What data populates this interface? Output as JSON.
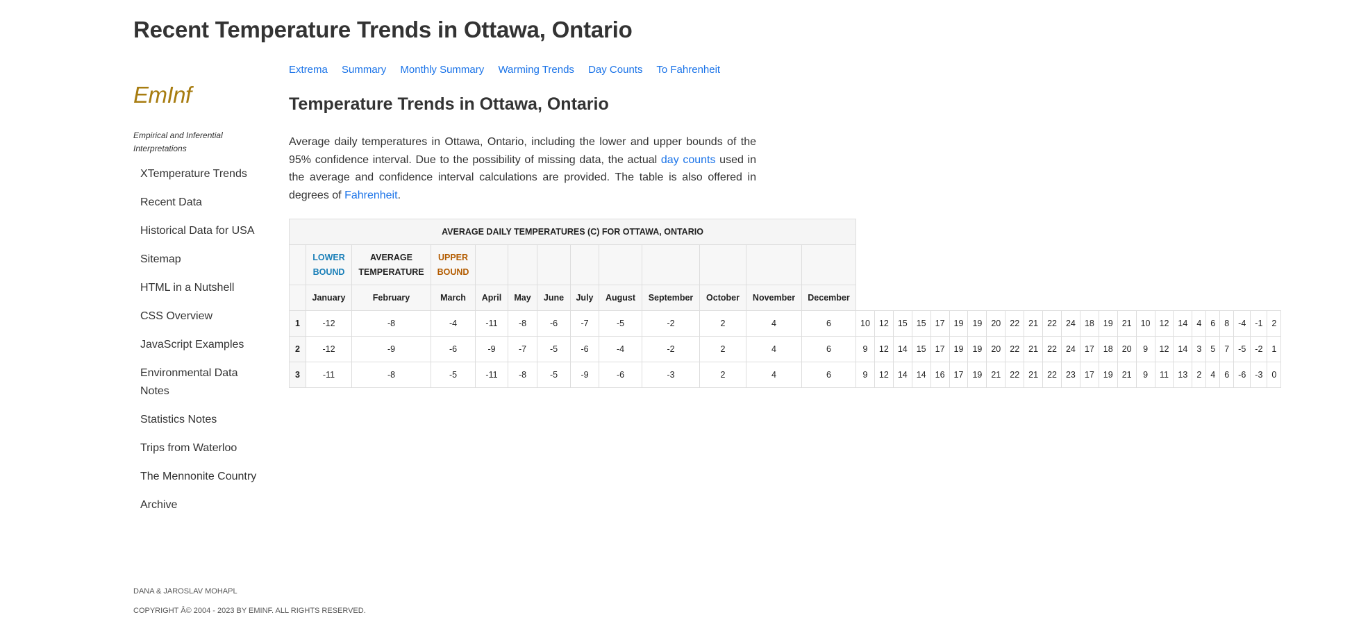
{
  "page_title": "Recent Temperature Trends in Ottawa, Ontario",
  "sidebar": {
    "logo": "EmInf",
    "tagline": "Empirical and Inferential Interpretations",
    "items": [
      {
        "label": "XTemperature Trends"
      },
      {
        "label": "Recent Data"
      },
      {
        "label": "Historical Data for USA"
      },
      {
        "label": "Sitemap"
      },
      {
        "label": "HTML in a Nutshell"
      },
      {
        "label": "CSS Overview"
      },
      {
        "label": "JavaScript Examples"
      },
      {
        "label": "Environmental Data Notes"
      },
      {
        "label": "Statistics Notes"
      },
      {
        "label": "Trips from Waterloo"
      },
      {
        "label": "The Mennonite Country"
      },
      {
        "label": "Archive"
      }
    ]
  },
  "footer": {
    "authors": "DANA & JAROSLAV MOHAPL",
    "copyright": "COPYRIGHT Â© 2004 - 2023 BY EmInf. ALL RIGHTS RESERVED."
  },
  "topnav": [
    "Extrema",
    "Summary",
    "Monthly Summary",
    "Warming Trends",
    "Day Counts",
    "To Fahrenheit"
  ],
  "section_title": "Temperature Trends in Ottawa, Ontario",
  "intro": {
    "part1": "Average daily temperatures in Ottawa, Ontario, including the lower and upper bounds of the 95% confidence interval. Due to the possibility of missing data, the actual ",
    "link1": "day counts",
    "part2": " used in the average and confidence interval calculations are provided. The table is also offered in degrees of ",
    "link2": "Fahrenheit",
    "part3": "."
  },
  "table": {
    "caption": "AVERAGE DAILY TEMPERATURES (C) FOR OTTAWA, ONTARIO",
    "lower_label": "LOWER BOUND",
    "avg_label": "AVERAGE TEMPERATURE",
    "upper_label": "UPPER BOUND",
    "colors": {
      "lower": "#1a7fb8",
      "upper": "#b35c00"
    },
    "months": [
      "January",
      "February",
      "March",
      "April",
      "May",
      "June",
      "July",
      "August",
      "September",
      "October",
      "November",
      "December"
    ],
    "rows": [
      {
        "idx": "1",
        "values": [
          "-12",
          "-8",
          "-4",
          "-11",
          "-8",
          "-6",
          "-7",
          "-5",
          "-2",
          "2",
          "4",
          "6",
          "10",
          "12",
          "15",
          "15",
          "17",
          "19",
          "19",
          "20",
          "22",
          "21",
          "22",
          "24",
          "18",
          "19",
          "21",
          "10",
          "12",
          "14",
          "4",
          "6",
          "8",
          "-4",
          "-1",
          "2"
        ]
      },
      {
        "idx": "2",
        "values": [
          "-12",
          "-9",
          "-6",
          "-9",
          "-7",
          "-5",
          "-6",
          "-4",
          "-2",
          "2",
          "4",
          "6",
          "9",
          "12",
          "14",
          "15",
          "17",
          "19",
          "19",
          "20",
          "22",
          "21",
          "22",
          "24",
          "17",
          "18",
          "20",
          "9",
          "12",
          "14",
          "3",
          "5",
          "7",
          "-5",
          "-2",
          "1"
        ]
      },
      {
        "idx": "3",
        "values": [
          "-11",
          "-8",
          "-5",
          "-11",
          "-8",
          "-5",
          "-9",
          "-6",
          "-3",
          "2",
          "4",
          "6",
          "9",
          "12",
          "14",
          "14",
          "16",
          "17",
          "19",
          "21",
          "22",
          "21",
          "22",
          "23",
          "17",
          "19",
          "21",
          "9",
          "11",
          "13",
          "2",
          "4",
          "6",
          "-6",
          "-3",
          "0"
        ]
      }
    ]
  }
}
